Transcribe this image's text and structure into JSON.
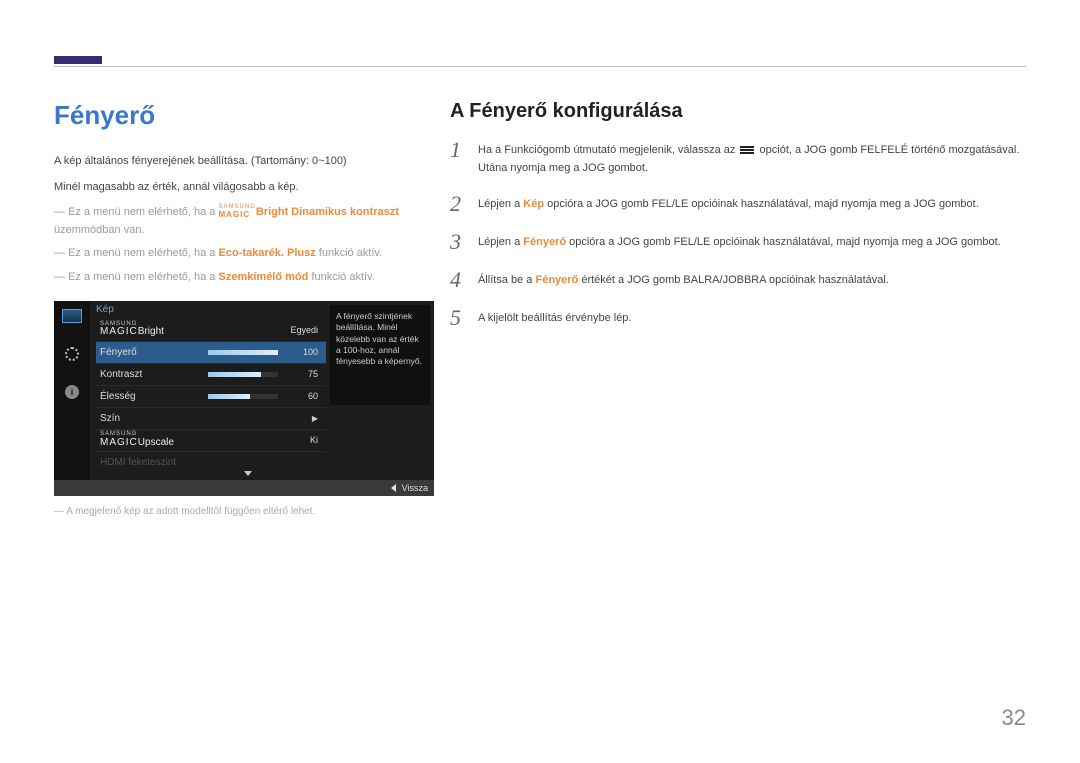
{
  "page_number": "32",
  "left": {
    "title": "Fényerő",
    "desc1": "A kép általános fényerejének beállítása. (Tartomány: 0~100)",
    "desc2": "Minél magasabb az érték, annál világosabb a kép.",
    "note1_pre": "Ez a menü nem elérhető, ha a ",
    "note1_magic_brand": "SAMSUNG",
    "note1_magic": "MAGIC",
    "note1_bright": "Bright",
    "note1_mode": " Dinamikus kontraszt",
    "note1_post": " üzemmódban van.",
    "note2_pre": "Ez a menü nem elérhető, ha a ",
    "note2_mode": "Eco-takarék. Plusz",
    "note2_post": " funkció aktív.",
    "note3_pre": "Ez a menü nem elérhető, ha a ",
    "note3_mode": "Szemkímélő mód",
    "note3_post": " funkció aktív.",
    "footer_note": "A megjelenő kép az adott modelltől függően eltérő lehet."
  },
  "right": {
    "title": "A Fényerő konfigurálása",
    "steps": [
      {
        "num": "1",
        "pre": "Ha a Funkciógomb útmutató megjelenik, válassza az ",
        "post": " opciót, a JOG gomb FELFELÉ történő mozgatásával. Utána nyomja meg a JOG gombot."
      },
      {
        "num": "2",
        "pre": "Lépjen a ",
        "hl": "Kép",
        "post": " opcióra a JOG gomb FEL/LE opcióinak használatával, majd nyomja meg a JOG gombot."
      },
      {
        "num": "3",
        "pre": "Lépjen a ",
        "hl": "Fényerő",
        "post": " opcióra a JOG gomb FEL/LE opcióinak használatával, majd nyomja meg a JOG gombot."
      },
      {
        "num": "4",
        "pre": "Állítsa be a ",
        "hl": "Fényerő",
        "post": " értékét a JOG gomb BALRA/JOBBRA opcióinak használatával."
      },
      {
        "num": "5",
        "pre": "A kijelölt beállítás érvénybe lép.",
        "hl": "",
        "post": ""
      }
    ]
  },
  "osd": {
    "header": "Kép",
    "rows": {
      "magic_brand": "SAMSUNG",
      "magic": "MAGIC",
      "bright_label": "Bright",
      "bright_value": "Egyedi",
      "brightness_label": "Fényerő",
      "brightness_value": "100",
      "contrast_label": "Kontraszt",
      "contrast_value": "75",
      "sharpness_label": "Élesség",
      "sharpness_value": "60",
      "color_label": "Szín",
      "upscale_label": "Upscale",
      "upscale_value": "Ki",
      "hdmi_label": "HDMI feketeszint"
    },
    "tooltip": "A fényerő szintjének beállítása. Minél közelebb van az érték a 100-hoz, annál fényesebb a képernyő.",
    "footer_back": "Vissza"
  },
  "chart_data": {
    "type": "bar",
    "title": "OSD sliders (percentage of range 0–100)",
    "categories": [
      "Fényerő",
      "Kontraszt",
      "Élesség"
    ],
    "values": [
      100,
      75,
      60
    ],
    "xlabel": "",
    "ylabel": "",
    "ylim": [
      0,
      100
    ]
  }
}
